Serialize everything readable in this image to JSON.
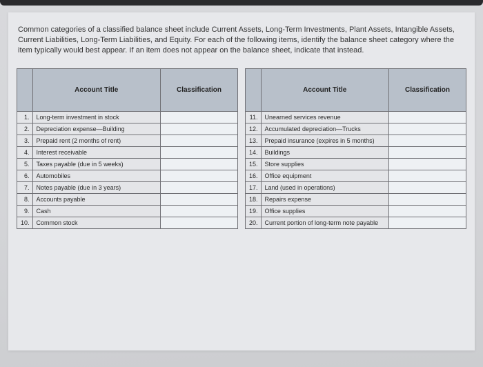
{
  "instructions": "Common categories of a classified balance sheet include Current Assets, Long-Term Investments, Plant Assets, Intangible Assets, Current Liabilities, Long-Term Liabilities, and Equity. For each of the following items, identify the balance sheet category where the item typically would best appear. If an item does not appear on the balance sheet, indicate that instead.",
  "headers": {
    "account_title": "Account Title",
    "classification": "Classification"
  },
  "left_rows": [
    {
      "n": "1.",
      "title": "Long-term investment in stock"
    },
    {
      "n": "2.",
      "title": "Depreciation expense—Building"
    },
    {
      "n": "3.",
      "title": "Prepaid rent (2 months of rent)"
    },
    {
      "n": "4.",
      "title": "Interest receivable"
    },
    {
      "n": "5.",
      "title": "Taxes payable (due in 5 weeks)"
    },
    {
      "n": "6.",
      "title": "Automobiles"
    },
    {
      "n": "7.",
      "title": "Notes payable (due in 3 years)"
    },
    {
      "n": "8.",
      "title": "Accounts payable"
    },
    {
      "n": "9.",
      "title": "Cash"
    },
    {
      "n": "10.",
      "title": "Common stock"
    }
  ],
  "right_rows": [
    {
      "n": "11.",
      "title": "Unearned services revenue"
    },
    {
      "n": "12.",
      "title": "Accumulated depreciation—Trucks"
    },
    {
      "n": "13.",
      "title": "Prepaid insurance (expires in 5 months)"
    },
    {
      "n": "14.",
      "title": "Buildings"
    },
    {
      "n": "15.",
      "title": "Store supplies"
    },
    {
      "n": "16.",
      "title": "Office equipment"
    },
    {
      "n": "17.",
      "title": "Land (used in operations)"
    },
    {
      "n": "18.",
      "title": "Repairs expense"
    },
    {
      "n": "19.",
      "title": "Office supplies"
    },
    {
      "n": "20.",
      "title": "Current portion of long-term note payable"
    }
  ]
}
